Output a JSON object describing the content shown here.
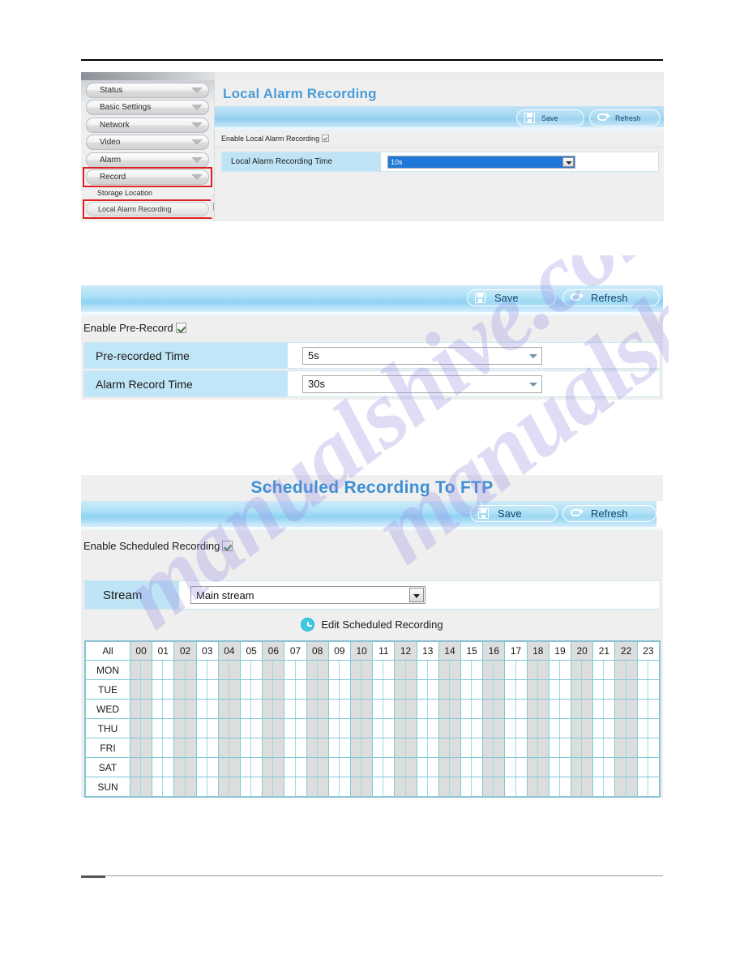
{
  "page": {
    "watermark": "manualshive.com"
  },
  "figure1": {
    "sidebar": {
      "items": [
        {
          "label": "Status",
          "icon": "chevron-down-icon"
        },
        {
          "label": "Basic Settings",
          "icon": "chevron-down-icon"
        },
        {
          "label": "Network",
          "icon": "chevron-down-icon"
        },
        {
          "label": "Video",
          "icon": "chevron-down-icon"
        },
        {
          "label": "Alarm",
          "icon": "chevron-down-icon"
        },
        {
          "label": "Record",
          "icon": "chevron-down-icon"
        }
      ],
      "sub_items": [
        {
          "label": "Storage Location"
        },
        {
          "label": "Local Alarm Recording"
        }
      ]
    },
    "title": "Local Alarm Recording",
    "save_label": "Save",
    "refresh_label": "Refresh",
    "enable_label": "Enable Local Alarm Recording",
    "row": {
      "label": "Local Alarm Recording Time",
      "value": "10s"
    }
  },
  "figure2": {
    "save_label": "Save",
    "refresh_label": "Refresh",
    "enable_label": "Enable Pre-Record",
    "rows": [
      {
        "label": "Pre-recorded Time",
        "value": "5s"
      },
      {
        "label": "Alarm Record Time",
        "value": "30s"
      }
    ]
  },
  "figure3": {
    "title": "Scheduled Recording To FTP",
    "save_label": "Save",
    "refresh_label": "Refresh",
    "enable_label": "Enable Scheduled Recording",
    "stream": {
      "label": "Stream",
      "value": "Main stream"
    },
    "edit_link_label": "Edit Scheduled Recording",
    "schedule": {
      "corner_label": "All",
      "hours": [
        "00",
        "01",
        "02",
        "03",
        "04",
        "05",
        "06",
        "07",
        "08",
        "09",
        "10",
        "11",
        "12",
        "13",
        "14",
        "15",
        "16",
        "17",
        "18",
        "19",
        "20",
        "21",
        "22",
        "23"
      ],
      "days": [
        "MON",
        "TUE",
        "WED",
        "THU",
        "FRI",
        "SAT",
        "SUN"
      ],
      "selected_cells": []
    }
  },
  "colors": {
    "accent_blue": "#3d8fd4",
    "label_cell": "#bfe4f5",
    "grid_line": "#7fcad8",
    "shade_col": "#dddddd",
    "highlight_red": "#e02020",
    "select_highlight": "#1e78d7"
  }
}
